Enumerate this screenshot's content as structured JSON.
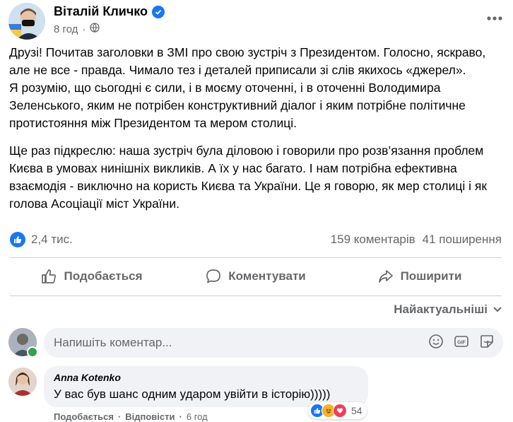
{
  "post": {
    "author": "Віталій Кличко",
    "time": "8 год",
    "paragraphs": [
      "Друзі! Почитав заголовки в ЗМІ про свою зустріч з Президентом. Голосно, яскраво, але не все - правда. Чимало тез і деталей приписали зі слів якихось «джерел».",
      "Я розумію, що сьогодні є сили, і в моєму оточенні, і в оточенні Володимира Зеленського, яким не потрібен конструктивний діалог і яким потрібне політичне протистояння між Президентом та мером столиці.",
      "Ще раз підкреслю: наша зустріч була діловою і говорили про розв’язання проблем Києва в умовах нинішніх викликів. А їх у нас багато. І нам потрібна ефективна взаємодія - виключно на користь Києва та України. Це я говорю, як мер столиці і як голова Асоціації міст України."
    ],
    "likes": "2,4 тис.",
    "comments": "159 коментарів",
    "shares": "41 поширення"
  },
  "actions": {
    "like": "Подобається",
    "comment": "Коментувати",
    "share": "Поширити"
  },
  "sort_label": "Найактуальніші",
  "comment_input": {
    "placeholder": "Напишіть коментар..."
  },
  "comments_list": [
    {
      "author": "Anna Kotenko",
      "text": "У вас був шанс одним ударом увійти в історію)))))",
      "reactions_count": "54",
      "like_label": "Подобається",
      "reply_label": "Відповісти",
      "time": "6 год"
    }
  ],
  "colors": {
    "accent": "#1877f2",
    "secondary_text": "#65676b",
    "input_bg": "#f0f2f5"
  }
}
